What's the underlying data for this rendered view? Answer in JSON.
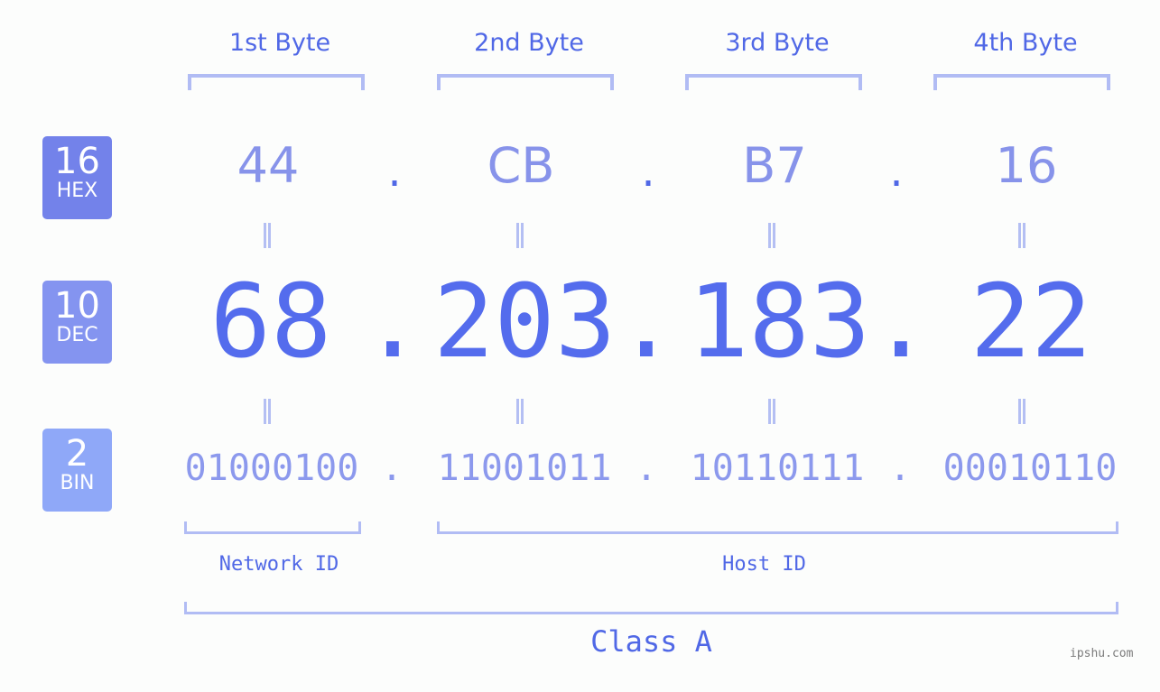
{
  "bytes": [
    {
      "header": "1st Byte",
      "hex": "44",
      "dec": "68",
      "bin": "01000100"
    },
    {
      "header": "2nd Byte",
      "hex": "CB",
      "dec": "203",
      "bin": "11001011"
    },
    {
      "header": "3rd Byte",
      "hex": "B7",
      "dec": "183",
      "bin": "10110111"
    },
    {
      "header": "4th Byte",
      "hex": "16",
      "dec": "22",
      "bin": "00010110"
    }
  ],
  "separator": ".",
  "equals_glyph": "||",
  "bases": {
    "hex": {
      "number": "16",
      "label": "HEX",
      "color": "#7382ea"
    },
    "dec": {
      "number": "10",
      "label": "DEC",
      "color": "#8494f0"
    },
    "bin": {
      "number": "2",
      "label": "BIN",
      "color": "#8fa8f8"
    }
  },
  "segments": {
    "network": "Network ID",
    "host": "Host ID",
    "class": "Class A"
  },
  "watermark": "ipshu.com",
  "colors": {
    "primary": "#546ced",
    "light": "#8793ea",
    "bracket": "#b1bcf4",
    "background": "#fcfdfc"
  }
}
